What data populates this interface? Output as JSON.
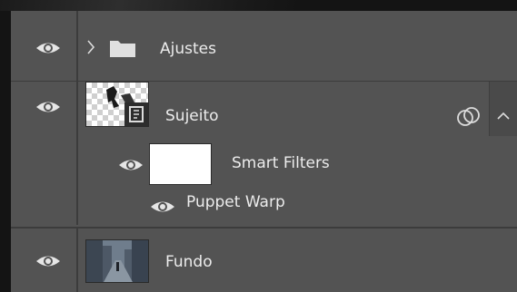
{
  "layers": {
    "ajustes": {
      "name": "Ajustes",
      "icons": [
        "eye-icon",
        "chevron-right-icon",
        "folder-icon"
      ]
    },
    "sujeito": {
      "name": "Sujeito",
      "icons": [
        "eye-icon",
        "smart-object-icon",
        "linked-circles-icon"
      ]
    },
    "smart_filters": {
      "name": "Smart Filters",
      "icons": [
        "eye-icon"
      ]
    },
    "puppet_warp": {
      "name": "Puppet Warp",
      "icons": [
        "eye-icon"
      ]
    },
    "fundo": {
      "name": "Fundo",
      "icons": [
        "eye-icon"
      ]
    }
  },
  "colors": {
    "panel_bg": "#535353",
    "divider": "#3c3c3c",
    "text": "#ececec",
    "outer_bg": "#141414"
  }
}
